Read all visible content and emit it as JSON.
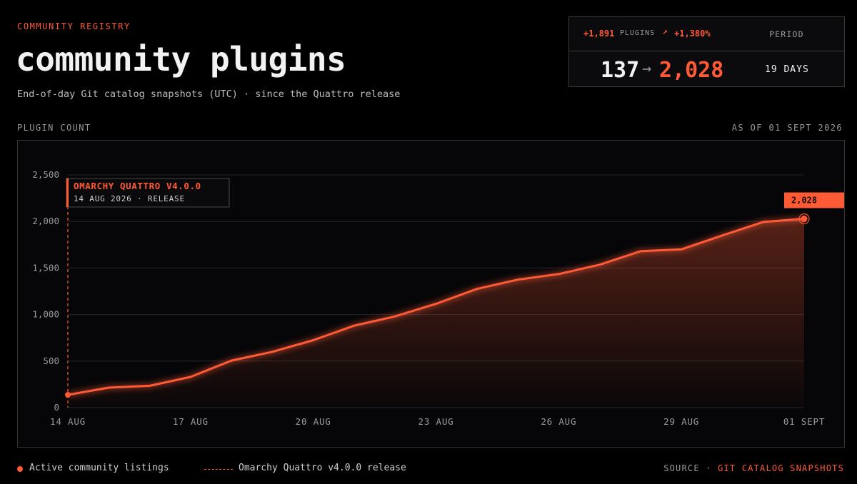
{
  "header": {
    "eyebrow": "COMMUNITY REGISTRY",
    "title": "community plugins",
    "subtitle": "End-of-day Git catalog snapshots (UTC) · since the Quattro release"
  },
  "stats": {
    "delta": "+1,891",
    "delta_unit": "PLUGINS",
    "pct_icon": "arrow-up-right-icon",
    "pct": "+1,380%",
    "period_label": "PERIOD",
    "from": "137",
    "to": "2,028",
    "period_value": "19 DAYS"
  },
  "plot": {
    "label": "PLUGIN COUNT",
    "as_of": "AS OF 01 SEPT 2026"
  },
  "legend": {
    "series_label": "Active community listings",
    "marker_label": "Omarchy Quattro v4.0.0 release"
  },
  "source": {
    "label": "SOURCE",
    "separator": "·",
    "value": "GIT CATALOG SNAPSHOTS"
  },
  "colors": {
    "accent": "#ff5a36",
    "grid": "#26262a",
    "muted": "#9a9a9a"
  },
  "chart_data": {
    "type": "line",
    "x": [
      "14 Aug",
      "15 Aug",
      "16 Aug",
      "17 Aug",
      "18 Aug",
      "19 Aug",
      "20 Aug",
      "21 Aug",
      "22 Aug",
      "23 Aug",
      "24 Aug",
      "25 Aug",
      "26 Aug",
      "27 Aug",
      "28 Aug",
      "29 Aug",
      "30 Aug",
      "31 Aug",
      "01 Sept"
    ],
    "series": [
      {
        "name": "Active community listings",
        "values": [
          137,
          215,
          235,
          330,
          505,
          600,
          725,
          880,
          980,
          1115,
          1275,
          1375,
          1435,
          1535,
          1680,
          1700,
          1850,
          1995,
          2028
        ]
      }
    ],
    "ylim": [
      0,
      2500
    ],
    "yticks": [
      0,
      500,
      1000,
      1500,
      2000,
      2500
    ],
    "ytick_labels": [
      "0",
      "500",
      "1,000",
      "1,500",
      "2,000",
      "2,500"
    ],
    "xtick_indices": [
      0,
      3,
      6,
      9,
      12,
      15,
      18
    ],
    "xtick_labels": [
      "14 AUG",
      "17 AUG",
      "20 AUG",
      "23 AUG",
      "26 AUG",
      "29 AUG",
      "01 SEPT"
    ],
    "grid": true,
    "annotation": {
      "x_index": 0,
      "title": "OMARCHY QUATTRO V4.0.0",
      "subtitle": "14 AUG 2026 · RELEASE"
    },
    "end_label": "2,028"
  }
}
